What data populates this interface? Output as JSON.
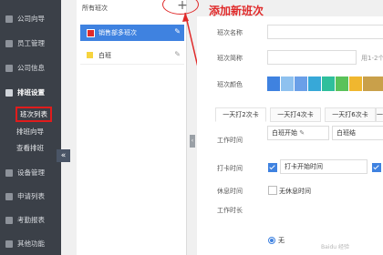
{
  "sidebar": {
    "items": [
      {
        "label": "公司向导",
        "icon": "home-icon"
      },
      {
        "label": "员工管理",
        "icon": "user-icon"
      },
      {
        "label": "公司信息",
        "icon": "building-icon"
      },
      {
        "label": "排班设置",
        "icon": "calendar-icon"
      }
    ],
    "subitems": [
      {
        "label": "班次列表"
      },
      {
        "label": "排班向导"
      },
      {
        "label": "查看排班"
      }
    ],
    "lower_items": [
      {
        "label": "设备管理",
        "icon": "device-icon"
      },
      {
        "label": "申请列表",
        "icon": "list-icon"
      },
      {
        "label": "考勤报表",
        "icon": "report-icon"
      },
      {
        "label": "其他功能",
        "icon": "more-icon"
      }
    ],
    "collapse_glyph": "«"
  },
  "panel": {
    "title": "所有班次",
    "add_glyph": "+",
    "shifts": [
      {
        "name": "销售部多班次",
        "color": "#e02a2a",
        "selected": true
      },
      {
        "name": "白班",
        "color": "#f7d43e",
        "selected": false
      }
    ]
  },
  "annotation": {
    "text": "添加新班次",
    "plus": "+"
  },
  "form": {
    "name_label": "班次名称",
    "short_label": "班次简称",
    "short_hint": "用1-2个",
    "color_label": "班次颜色",
    "colors": [
      "#3f82e0",
      "#8ec1ef",
      "#6a9fe8",
      "#37a8d8",
      "#2fbf9c",
      "#5ac25a",
      "#f0b72f"
    ],
    "tabs": [
      "一天打2次卡",
      "一天打4次卡",
      "一天打6次卡",
      "一天打"
    ],
    "work_time_label": "工作时间",
    "work_start": "白班开始",
    "work_end": "白班结",
    "punch_label": "打卡时间",
    "punch_start": "打卡开始时间",
    "rest_label": "休息时间",
    "no_rest": "无休息时间",
    "work_length_label": "工作时长",
    "radio_none": "无"
  },
  "watermark": "Baidu 经验"
}
